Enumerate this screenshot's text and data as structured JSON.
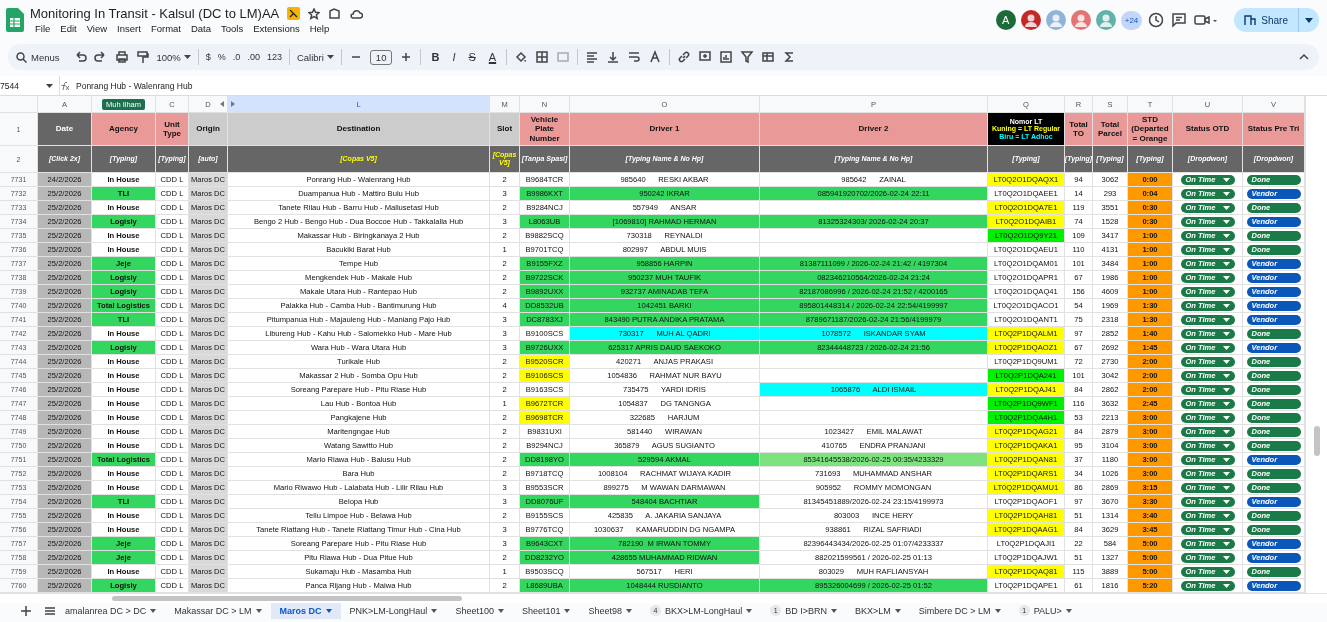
{
  "window": {
    "title": "Monitoring In Transit - Kalsul (DC to LM)AA",
    "menu": [
      "File",
      "Edit",
      "View",
      "Insert",
      "Format",
      "Data",
      "Tools",
      "Extensions",
      "Help"
    ],
    "avatar_letter": "A",
    "more_people": "+24",
    "share": "Share"
  },
  "toolbar": {
    "search": "Menus",
    "zoom": "100%",
    "format_items": [
      "$",
      "%",
      ".0",
      ".00",
      "123"
    ],
    "font": "Calibri",
    "font_size": "10",
    "style_items": [
      "B",
      "I",
      "S",
      "A"
    ]
  },
  "formula_bar": {
    "cell": "7544",
    "value": "Ponrang Hub - Walenrang Hub"
  },
  "header_row_numbers": [
    "1",
    "2"
  ],
  "columns": [
    {
      "letter": "A",
      "title": "Date",
      "subtitle": "[Click 2x]",
      "kind": "dark",
      "selected": false
    },
    {
      "collaborator": "Muh Ilham",
      "title": "Agency",
      "subtitle": "[Typing]",
      "kind": "pink",
      "selected": false
    },
    {
      "letter": "C",
      "title": "Unit Type",
      "subtitle": "[Typing]",
      "kind": "pink",
      "selected": false
    },
    {
      "letter": "D",
      "title": "Origin",
      "subtitle": "[auto]",
      "kind": "grey",
      "selected": false
    },
    {
      "letter": "L",
      "title": "Destination",
      "subtitle": "[Copas V5]",
      "subtitle_highlight": true,
      "kind": "grey",
      "selected": true
    },
    {
      "letter": "M",
      "title": "Slot",
      "subtitle": "[Copas V5]",
      "subtitle_highlight": true,
      "kind": "grey",
      "selected": false
    },
    {
      "letter": "N",
      "title": "Vehicle Plate Number",
      "subtitle": "[Tanpa Spasi]",
      "kind": "pink",
      "selected": false
    },
    {
      "letter": "O",
      "title": "Driver 1",
      "subtitle": "[Typing Name & No Hp]",
      "kind": "pink",
      "selected": false
    },
    {
      "letter": "P",
      "title": "Driver 2",
      "subtitle": "[Typing Name & No Hp]",
      "kind": "pink",
      "selected": false
    },
    {
      "letter": "Q",
      "title": "Nomor LT",
      "legend": [
        {
          "text": "Kuning = LT Regular",
          "color": "#ffff00"
        },
        {
          "text": "Biru = LT Adhoc",
          "color": "#00ffff"
        }
      ],
      "subtitle": "[Typing]",
      "kind": "black",
      "selected": false
    },
    {
      "letter": "R",
      "title": "Total TO",
      "subtitle": "[Typing]",
      "kind": "pink",
      "selected": false
    },
    {
      "letter": "S",
      "title": "Total Parcel",
      "subtitle": "[Typing]",
      "kind": "pink",
      "selected": false
    },
    {
      "letter": "T",
      "title": "STD (Departed = Orange",
      "subtitle": "[Typing]",
      "kind": "pink",
      "selected": false
    },
    {
      "letter": "U",
      "title": "Status OTD",
      "subtitle": "[Dropdwon]",
      "kind": "pink",
      "selected": false
    },
    {
      "letter": "V",
      "title": "Status Pre Tri",
      "subtitle": "[Dropdwon]",
      "kind": "pink",
      "selected": false
    }
  ],
  "rows": [
    {
      "row": "7731",
      "date": "24/2/2026",
      "agency": {
        "text": "In House"
      },
      "unit": "CDD L",
      "origin": "Maros DC",
      "dest": "Ponrang Hub - Walenrang Hub",
      "slot": "2",
      "plate": {
        "text": "B9684TCR"
      },
      "driver_1": {
        "text": "985640      RESKI AKBAR"
      },
      "driver_2": {
        "text": "985642      ZAINAL"
      },
      "lt": {
        "text": "LT0Q2O1DQAQX1",
        "color": "#ffff00"
      },
      "total_to": "94",
      "total_parcel": "3062",
      "std": "0:00",
      "otd": "On Time",
      "pre_trip": {
        "label": "Done",
        "kind": "done"
      }
    },
    {
      "row": "7732",
      "date": "25/2/2026",
      "agency": {
        "text": "TLI",
        "color": "#33d65e"
      },
      "unit": "CDD L",
      "origin": "Maros DC",
      "dest": "Duampanua Hub - Mattiro Bulu Hub",
      "slot": "3",
      "plate": {
        "text": "B9986KXT",
        "color": "#33d65e"
      },
      "driver_1": {
        "text": "950242 IKRAR",
        "color": "#33d65e"
      },
      "driver_2": {
        "text": "085941920702/2026-02-24 22:11",
        "color": "#33d65e"
      },
      "lt": {
        "text": "LT0Q2O1DQAEE1"
      },
      "total_to": "14",
      "total_parcel": "293",
      "std": "0:04",
      "otd": "On Time",
      "pre_trip": {
        "label": "Vendor",
        "kind": "vendor"
      }
    },
    {
      "row": "7733",
      "date": "25/2/2026",
      "agency": {
        "text": "In House"
      },
      "unit": "CDD L",
      "origin": "Maros DC",
      "dest": "Tanete Rilau Hub - Barru Hub - Mallusetasi Hub",
      "slot": "2",
      "plate": {
        "text": "B9284NCJ"
      },
      "driver_1": {
        "text": "557949      ANSAR"
      },
      "lt": {
        "text": "LT0Q2O1DQA7E1",
        "color": "#ffff00"
      },
      "total_to": "119",
      "total_parcel": "3551",
      "std": "0:30",
      "otd": "On Time",
      "pre_trip": {
        "label": "Done",
        "kind": "done"
      }
    },
    {
      "row": "7734",
      "date": "25/2/2026",
      "agency": {
        "text": "Logisly",
        "color": "#33d65e"
      },
      "unit": "CDD L",
      "origin": "Maros DC",
      "dest": "Bengo 2 Hub - Bengo Hub - Dua Boccoe Hub - Takkalalla Hub",
      "slot": "3",
      "plate": {
        "text": "L8063UB",
        "color": "#33d65e"
      },
      "driver_1": {
        "text": "[1069810] RAHMAD HERMAN",
        "color": "#33d65e"
      },
      "driver_2": {
        "text": "81325324303/ 2026-02-24 20:37",
        "color": "#33d65e"
      },
      "lt": {
        "text": "LT0Q2O1DQAIB1",
        "color": "#ffff00"
      },
      "total_to": "74",
      "total_parcel": "1528",
      "std": "0:30",
      "otd": "On Time",
      "pre_trip": {
        "label": "Vendor",
        "kind": "vendor"
      }
    },
    {
      "row": "7735",
      "date": "25/2/2026",
      "agency": {
        "text": "In House"
      },
      "unit": "CDD L",
      "origin": "Maros DC",
      "dest": "Makassar Hub - Biringkanaya 2 Hub",
      "slot": "2",
      "plate": {
        "text": "B9882SCQ"
      },
      "driver_1": {
        "text": "730318      REYNALDI"
      },
      "lt": {
        "text": "LT0Q2O1DQ9Y21",
        "color": "#00f000"
      },
      "total_to": "109",
      "total_parcel": "3417",
      "std": "1:00",
      "otd": "On Time",
      "pre_trip": {
        "label": "Done",
        "kind": "done"
      }
    },
    {
      "row": "7736",
      "date": "25/2/2026",
      "agency": {
        "text": "In House"
      },
      "unit": "CDD L",
      "origin": "Maros DC",
      "dest": "Bacukiki Barat Hub",
      "slot": "1",
      "plate": {
        "text": "B9701TCQ"
      },
      "driver_1": {
        "text": "802997      ABDUL MUIS"
      },
      "lt": {
        "text": "LT0Q2O1DQAEU1"
      },
      "total_to": "110",
      "total_parcel": "4131",
      "std": "1:00",
      "otd": "On Time",
      "pre_trip": {
        "label": "Done",
        "kind": "done"
      }
    },
    {
      "row": "7737",
      "date": "25/2/2026",
      "agency": {
        "text": "Jeje",
        "color": "#33d65e"
      },
      "unit": "CDD L",
      "origin": "Maros DC",
      "dest": "Tempe Hub",
      "slot": "2",
      "plate": {
        "text": "B9155FXZ",
        "color": "#33d65e"
      },
      "driver_1": {
        "text": "958856 HARPIN",
        "color": "#33d65e"
      },
      "driver_2": {
        "text": "81387111099 / 2026-02-24 21:42 / 4197304",
        "color": "#33d65e"
      },
      "lt": {
        "text": "LT0Q2O1DQAM01"
      },
      "total_to": "101",
      "total_parcel": "3484",
      "std": "1:00",
      "otd": "On Time",
      "pre_trip": {
        "label": "Vendor",
        "kind": "vendor"
      }
    },
    {
      "row": "7738",
      "date": "25/2/2026",
      "agency": {
        "text": "Logisly",
        "color": "#33d65e"
      },
      "unit": "CDD L",
      "origin": "Maros DC",
      "dest": "Mengkendek Hub - Makale Hub",
      "slot": "2",
      "plate": {
        "text": "B9722SCK",
        "color": "#33d65e"
      },
      "driver_1": {
        "text": "950237 MUH TAUFIK",
        "color": "#33d65e"
      },
      "driver_2": {
        "text": "082346210564/2026-02-24 21:24",
        "color": "#33d65e"
      },
      "lt": {
        "text": "LT0Q2O1DQAPR1"
      },
      "total_to": "67",
      "total_parcel": "1986",
      "std": "1:00",
      "otd": "On Time",
      "pre_trip": {
        "label": "Vendor",
        "kind": "vendor"
      }
    },
    {
      "row": "7739",
      "date": "25/2/2026",
      "agency": {
        "text": "Logisly",
        "color": "#33d65e"
      },
      "unit": "CDD L",
      "origin": "Maros DC",
      "dest": "Makale Utara Hub - Rantepao Hub",
      "slot": "2",
      "plate": {
        "text": "B9892UXX",
        "color": "#33d65e"
      },
      "driver_1": {
        "text": "932737 AMINADAB TEFA",
        "color": "#33d65e"
      },
      "driver_2": {
        "text": "82187086996 / 2026-02-24 21:52 / 4200165",
        "color": "#33d65e"
      },
      "lt": {
        "text": "LT0Q2O1DQAQ41"
      },
      "total_to": "156",
      "total_parcel": "4609",
      "std": "1:00",
      "otd": "On Time",
      "pre_trip": {
        "label": "Vendor",
        "kind": "vendor"
      }
    },
    {
      "row": "7740",
      "date": "25/2/2026",
      "agency": {
        "text": "Total Logistics",
        "color": "#33d65e"
      },
      "unit": "CDD L",
      "origin": "Maros DC",
      "dest": "Palakka Hub - Camba Hub - Bantimurung Hub",
      "slot": "4",
      "plate": {
        "text": "DD8532UB",
        "color": "#33d65e"
      },
      "driver_1": {
        "text": "1042451 BARKI",
        "color": "#33d65e"
      },
      "driver_2": {
        "text": "895801448314 / 2026-02-24 22:54/4199997",
        "color": "#33d65e"
      },
      "lt": {
        "text": "LT0Q2O1DQACO1"
      },
      "total_to": "54",
      "total_parcel": "1969",
      "std": "1:30",
      "otd": "On Time",
      "pre_trip": {
        "label": "Vendor",
        "kind": "vendor"
      }
    },
    {
      "row": "7741",
      "date": "25/2/2026",
      "agency": {
        "text": "TLI",
        "color": "#33d65e"
      },
      "unit": "CDD L",
      "origin": "Maros DC",
      "dest": "Pitumpanua Hub - Majauleng Hub - Maniang Pajo Hub",
      "slot": "3",
      "plate": {
        "text": "DC8783XJ",
        "color": "#33d65e"
      },
      "driver_1": {
        "text": "843490 PUTRA ANDIKA PRATAMA",
        "color": "#33d65e"
      },
      "driver_2": {
        "text": "8789671187/2026-02-24 21:56/4199979",
        "color": "#33d65e"
      },
      "lt": {
        "text": "LT0Q2O1DQANT1"
      },
      "total_to": "75",
      "total_parcel": "2318",
      "std": "1:30",
      "otd": "On Time",
      "pre_trip": {
        "label": "Vendor",
        "kind": "vendor"
      }
    },
    {
      "row": "7742",
      "date": "25/2/2026",
      "agency": {
        "text": "In House"
      },
      "unit": "CDD L",
      "origin": "Maros DC",
      "dest": "Libureng Hub - Kahu Hub - Salomekko Hub - Mare Hub",
      "slot": "3",
      "plate": {
        "text": "B9100SCS"
      },
      "driver_1": {
        "text": "730317      MUH AL QADRI",
        "color": "#00ffff"
      },
      "driver_2": {
        "text": "1078572      ISKANDAR SYAM",
        "color": "#00ffff"
      },
      "lt": {
        "text": "LT0Q2P1DQALM1",
        "color": "#ffff00"
      },
      "total_to": "97",
      "total_parcel": "2852",
      "std": "1:40",
      "otd": "On Time",
      "pre_trip": {
        "label": "Done",
        "kind": "done"
      }
    },
    {
      "row": "7743",
      "date": "25/2/2026",
      "agency": {
        "text": "Logisly",
        "color": "#33d65e"
      },
      "unit": "CDD L",
      "origin": "Maros DC",
      "dest": "Wara Hub - Wara Utara Hub",
      "slot": "3",
      "plate": {
        "text": "B9726UXX",
        "color": "#33d65e"
      },
      "driver_1": {
        "text": "625317 APRIS DAUD SAEKOKO",
        "color": "#33d65e"
      },
      "driver_2": {
        "text": "82344448723 / 2026-02-24 21:56",
        "color": "#33d65e"
      },
      "lt": {
        "text": "LT0Q2P1DQAOZ1",
        "color": "#ffff00"
      },
      "total_to": "67",
      "total_parcel": "2692",
      "std": "1:45",
      "otd": "On Time",
      "pre_trip": {
        "label": "Vendor",
        "kind": "vendor"
      }
    },
    {
      "row": "7744",
      "date": "25/2/2026",
      "agency": {
        "text": "In House"
      },
      "unit": "CDD L",
      "origin": "Maros DC",
      "dest": "Turikale Hub",
      "slot": "2",
      "plate": {
        "text": "B9520SCR",
        "color": "#ffff00"
      },
      "driver_1": {
        "text": "420271      ANJAS PRAKASI"
      },
      "lt": {
        "text": "LT0Q2P1DQ9UM1"
      },
      "total_to": "72",
      "total_parcel": "2730",
      "std": "2:00",
      "otd": "On Time",
      "pre_trip": {
        "label": "Done",
        "kind": "done"
      }
    },
    {
      "row": "7745",
      "date": "25/2/2026",
      "agency": {
        "text": "In House"
      },
      "unit": "CDD L",
      "origin": "Maros DC",
      "dest": "Makassar 2 Hub - Somba Opu Hub",
      "slot": "2",
      "plate": {
        "text": "B9106SCS",
        "color": "#ffff00"
      },
      "driver_1": {
        "text": "1054836      RAHMAT NUR BAYU"
      },
      "lt": {
        "text": "LT0Q2P1DQA241",
        "color": "#00f000"
      },
      "total_to": "101",
      "total_parcel": "3042",
      "std": "2:00",
      "otd": "On Time",
      "pre_trip": {
        "label": "Done",
        "kind": "done"
      }
    },
    {
      "row": "7746",
      "date": "25/2/2026",
      "agency": {
        "text": "In House"
      },
      "unit": "CDD L",
      "origin": "Maros DC",
      "dest": "Soreang Parepare Hub - Pitu Riase Hub",
      "slot": "2",
      "plate": {
        "text": "B9163SCS"
      },
      "driver_1": {
        "text": "735475      YARDI IDRIS"
      },
      "driver_2": {
        "text": "1065876      ALDI ISMAIL",
        "color": "#00ffff"
      },
      "lt": {
        "text": "LT0Q2P1DQAJ41",
        "color": "#ffff00"
      },
      "total_to": "84",
      "total_parcel": "2862",
      "std": "2:00",
      "otd": "On Time",
      "pre_trip": {
        "label": "Done",
        "kind": "done"
      }
    },
    {
      "row": "7747",
      "date": "25/2/2026",
      "agency": {
        "text": "In House"
      },
      "unit": "CDD L",
      "origin": "Maros DC",
      "dest": "Lau Hub - Bontoa Hub",
      "slot": "1",
      "plate": {
        "text": "B9672TCR",
        "color": "#ffff00"
      },
      "driver_1": {
        "text": "1054837      DG TANGNGA"
      },
      "lt": {
        "text": "LT0Q2P1DQ9WF1",
        "color": "#00f000"
      },
      "total_to": "116",
      "total_parcel": "3632",
      "std": "2:45",
      "otd": "On Time",
      "pre_trip": {
        "label": "Done",
        "kind": "done"
      }
    },
    {
      "row": "7748",
      "date": "25/2/2026",
      "agency": {
        "text": "In House"
      },
      "unit": "CDD L",
      "origin": "Maros DC",
      "dest": "Pangkajene Hub",
      "slot": "2",
      "plate": {
        "text": "B9698TCR",
        "color": "#ffff00"
      },
      "driver_1": {
        "text": "322685      HARJUM"
      },
      "lt": {
        "text": "LT0Q2P1DQA4H1",
        "color": "#00f000"
      },
      "total_to": "53",
      "total_parcel": "2213",
      "std": "3:00",
      "otd": "On Time",
      "pre_trip": {
        "label": "Done",
        "kind": "done"
      }
    },
    {
      "row": "7749",
      "date": "25/2/2026",
      "agency": {
        "text": "In House"
      },
      "unit": "CDD L",
      "origin": "Maros DC",
      "dest": "Maritengngae Hub",
      "slot": "2",
      "plate": {
        "text": "B9831UXI"
      },
      "driver_1": {
        "text": "581440      WIRAWAN"
      },
      "driver_2": {
        "text": "1023427      EMIL MALAWAT"
      },
      "lt": {
        "text": "LT0Q2P1DQAG21",
        "color": "#ffff00"
      },
      "total_to": "84",
      "total_parcel": "2879",
      "std": "3:00",
      "otd": "On Time",
      "pre_trip": {
        "label": "Done",
        "kind": "done"
      }
    },
    {
      "row": "7750",
      "date": "25/2/2026",
      "agency": {
        "text": "In House"
      },
      "unit": "CDD L",
      "origin": "Maros DC",
      "dest": "Watang Sawitto Hub",
      "slot": "2",
      "plate": {
        "text": "B9294NCJ"
      },
      "driver_1": {
        "text": "365879      AGUS SUGIANTO"
      },
      "driver_2": {
        "text": "410765      ENDRA PRANJANI"
      },
      "lt": {
        "text": "LT0Q2P1DQAKA1",
        "color": "#ffff00"
      },
      "total_to": "95",
      "total_parcel": "3104",
      "std": "3:00",
      "otd": "On Time",
      "pre_trip": {
        "label": "Done",
        "kind": "done"
      }
    },
    {
      "row": "7751",
      "date": "25/2/2026",
      "agency": {
        "text": "Total Logistics",
        "color": "#33d65e"
      },
      "unit": "CDD L",
      "origin": "Maros DC",
      "dest": "Mario Riawa Hub - Balusu Hub",
      "slot": "2",
      "plate": {
        "text": "DD8198YO",
        "color": "#33d65e"
      },
      "driver_1": {
        "text": "529594 AKMAL",
        "color": "#33d65e"
      },
      "driver_2": {
        "text": "85341645538/2026-02-25 00:35/4233329",
        "color": "#7ee37e"
      },
      "lt": {
        "text": "LT0Q2P1DQAN81",
        "color": "#ffff00"
      },
      "total_to": "37",
      "total_parcel": "1180",
      "std": "3:00",
      "otd": "On Time",
      "pre_trip": {
        "label": "Vendor",
        "kind": "vendor"
      }
    },
    {
      "row": "7752",
      "date": "25/2/2026",
      "agency": {
        "text": "In House"
      },
      "unit": "CDD L",
      "origin": "Maros DC",
      "dest": "Bara Hub",
      "slot": "2",
      "plate": {
        "text": "B9718TCQ"
      },
      "driver_1": {
        "text": "1008104      RACHMAT WIJAYA KADIR"
      },
      "driver_2": {
        "text": "731693      MUHAMMAD ANSHAR"
      },
      "lt": {
        "text": "LT0Q2P1DQARS1",
        "color": "#ffff00"
      },
      "total_to": "34",
      "total_parcel": "1026",
      "std": "3:00",
      "otd": "On Time",
      "pre_trip": {
        "label": "Done",
        "kind": "done"
      }
    },
    {
      "row": "7753",
      "date": "25/2/2026",
      "agency": {
        "text": "In House"
      },
      "unit": "CDD L",
      "origin": "Maros DC",
      "dest": "Mario Riwawo Hub - Lalabata Hub - Lilir Rilau Hub",
      "slot": "3",
      "plate": {
        "text": "B9553SCR"
      },
      "driver_1": {
        "text": "899275      M WAWAN DARMAWAN"
      },
      "driver_2": {
        "text": "905952      ROMMY MOMONGAN"
      },
      "lt": {
        "text": "LT0Q2P1DQAMU1",
        "color": "#ffff00"
      },
      "total_to": "86",
      "total_parcel": "2869",
      "std": "3:15",
      "otd": "On Time",
      "pre_trip": {
        "label": "Done",
        "kind": "done"
      }
    },
    {
      "row": "7754",
      "date": "25/2/2026",
      "agency": {
        "text": "TLI",
        "color": "#33d65e"
      },
      "unit": "CDD L",
      "origin": "Maros DC",
      "dest": "Belopa Hub",
      "slot": "3",
      "plate": {
        "text": "DD8076UF",
        "color": "#33d65e"
      },
      "driver_1": {
        "text": "548404 BACHTIAR",
        "color": "#33d65e"
      },
      "driver_2": {
        "text": "81345451889/2026-02-24 23:15/4199973"
      },
      "lt": {
        "text": "LT0Q2P1DQAOF1"
      },
      "total_to": "97",
      "total_parcel": "3670",
      "std": "3:30",
      "otd": "On Time",
      "pre_trip": {
        "label": "Vendor",
        "kind": "vendor"
      }
    },
    {
      "row": "7755",
      "date": "25/2/2026",
      "agency": {
        "text": "In House"
      },
      "unit": "CDD L",
      "origin": "Maros DC",
      "dest": "Tellu Limpoe Hub - Belawa Hub",
      "slot": "2",
      "plate": {
        "text": "B9155SCS"
      },
      "driver_1": {
        "text": "425835      A. JAKARIA SANJAYA"
      },
      "driver_2": {
        "text": "803003      INCE HERY"
      },
      "lt": {
        "text": "LT0Q2P1DQAH81",
        "color": "#ffff00"
      },
      "total_to": "51",
      "total_parcel": "1314",
      "std": "3:40",
      "otd": "On Time",
      "pre_trip": {
        "label": "Done",
        "kind": "done"
      }
    },
    {
      "row": "7756",
      "date": "25/2/2026",
      "agency": {
        "text": "In House"
      },
      "unit": "CDD L",
      "origin": "Maros DC",
      "dest": "Tanete Riattang Hub - Tanete Riattang Timur Hub - Cina Hub",
      "slot": "3",
      "plate": {
        "text": "B9776TCQ"
      },
      "driver_1": {
        "text": "1030637      KAMARUDDIN DG NGAMPA"
      },
      "driver_2": {
        "text": "938861      RIZAL SAFRIADI"
      },
      "lt": {
        "text": "LT0Q2P1DQAAG1",
        "color": "#ffff00"
      },
      "total_to": "84",
      "total_parcel": "3629",
      "std": "3:45",
      "otd": "On Time",
      "pre_trip": {
        "label": "Done",
        "kind": "done"
      }
    },
    {
      "row": "7757",
      "date": "25/2/2026",
      "agency": {
        "text": "Jeje",
        "color": "#33d65e"
      },
      "unit": "CDD L",
      "origin": "Maros DC",
      "dest": "Soreang Parepare Hub - Pitu Riase Hub",
      "slot": "3",
      "plate": {
        "text": "B9643CXT",
        "color": "#33d65e"
      },
      "driver_1": {
        "text": "782190  M IRWAN TOMMY",
        "color": "#33d65e"
      },
      "driver_2": {
        "text": "82396443434/2026-02-25 01:07/4233337"
      },
      "lt": {
        "text": "LT0Q2P1DQAJI1"
      },
      "total_to": "22",
      "total_parcel": "584",
      "std": "5:00",
      "otd": "On Time",
      "pre_trip": {
        "label": "Vendor",
        "kind": "vendor"
      }
    },
    {
      "row": "7758",
      "date": "25/2/2026",
      "agency": {
        "text": "Jeje",
        "color": "#33d65e"
      },
      "unit": "CDD L",
      "origin": "Maros DC",
      "dest": "Pitu Riawa Hub - Dua Pitue Hub",
      "slot": "2",
      "plate": {
        "text": "DD8232YO",
        "color": "#33d65e"
      },
      "driver_1": {
        "text": "428655 MUHAMMAD RIDWAN",
        "color": "#33d65e"
      },
      "driver_2": {
        "text": "882021599561 / 2026-02-25 01:13"
      },
      "lt": {
        "text": "LT0Q2P1DQAJW1"
      },
      "total_to": "51",
      "total_parcel": "1327",
      "std": "5:00",
      "otd": "On Time",
      "pre_trip": {
        "label": "Vendor",
        "kind": "vendor"
      }
    },
    {
      "row": "7759",
      "date": "25/2/2026",
      "agency": {
        "text": "In House"
      },
      "unit": "CDD L",
      "origin": "Maros DC",
      "dest": "Sukamaju Hub - Masamba Hub",
      "slot": "1",
      "plate": {
        "text": "B9503SCQ"
      },
      "driver_1": {
        "text": "567517      HERI"
      },
      "driver_2": {
        "text": "803029      MUH RAFLIANSYAH"
      },
      "lt": {
        "text": "LT0Q2P1DQAQ81",
        "color": "#ffff00"
      },
      "total_to": "115",
      "total_parcel": "3889",
      "std": "5:00",
      "otd": "On Time",
      "pre_trip": {
        "label": "Done",
        "kind": "done"
      }
    },
    {
      "row": "7760",
      "date": "25/2/2026",
      "agency": {
        "text": "Logisly",
        "color": "#33d65e"
      },
      "unit": "CDD L",
      "origin": "Maros DC",
      "dest": "Panca Rijang Hub - Maiwa Hub",
      "slot": "2",
      "plate": {
        "text": "L8689UBA",
        "color": "#33d65e"
      },
      "driver_1": {
        "text": "1048444 RUSDIANTO",
        "color": "#33d65e"
      },
      "driver_2": {
        "text": "895326004699 / 2026-02-25 01:52",
        "color": "#33d65e"
      },
      "lt": {
        "text": "LT0Q2P1DQAPE1"
      },
      "total_to": "61",
      "total_parcel": "1816",
      "std": "5:20",
      "otd": "On Time",
      "pre_trip": {
        "label": "Vendor",
        "kind": "vendor"
      }
    }
  ],
  "sheet_tabs": [
    {
      "label": "amalanrea DC > DC",
      "selected": false
    },
    {
      "label": "Makassar DC > LM",
      "selected": false
    },
    {
      "label": "Maros DC",
      "selected": true
    },
    {
      "label": "PNK>LM-LongHaul",
      "selected": false
    },
    {
      "label": "Sheet100",
      "selected": false
    },
    {
      "label": "Sheet101",
      "selected": false
    },
    {
      "label": "Sheet98",
      "selected": false
    },
    {
      "label": "BKX>LM-LongHaul",
      "badge": "4",
      "selected": false
    },
    {
      "label": "BD I>BRN",
      "badge": "1",
      "selected": false
    },
    {
      "label": "BKX>LM",
      "selected": false
    },
    {
      "label": "Simbere DC > LM",
      "selected": false
    },
    {
      "label": "PALU>",
      "badge": "1",
      "selected": false
    }
  ]
}
